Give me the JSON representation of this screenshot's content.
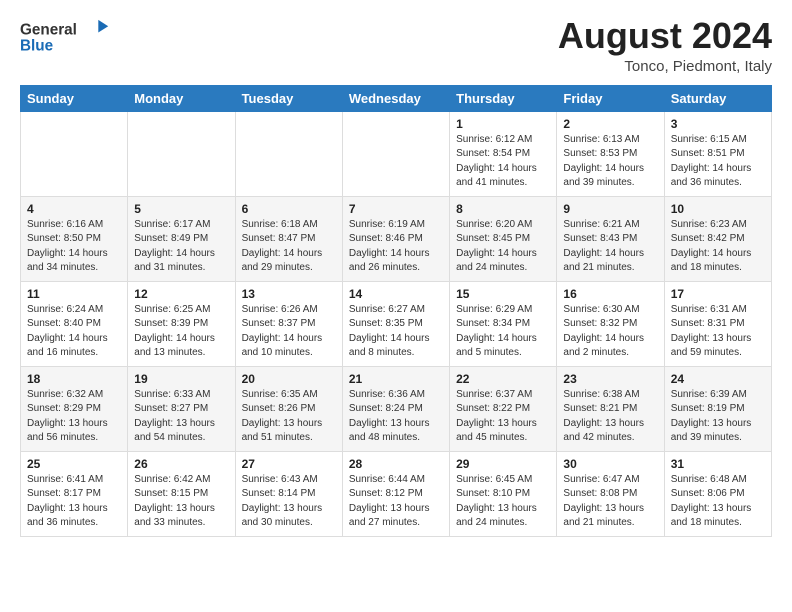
{
  "header": {
    "logo_line1": "General",
    "logo_line2": "Blue",
    "month": "August 2024",
    "location": "Tonco, Piedmont, Italy"
  },
  "days_of_week": [
    "Sunday",
    "Monday",
    "Tuesday",
    "Wednesday",
    "Thursday",
    "Friday",
    "Saturday"
  ],
  "weeks": [
    [
      {
        "day": "",
        "info": ""
      },
      {
        "day": "",
        "info": ""
      },
      {
        "day": "",
        "info": ""
      },
      {
        "day": "",
        "info": ""
      },
      {
        "day": "1",
        "info": "Sunrise: 6:12 AM\nSunset: 8:54 PM\nDaylight: 14 hours\nand 41 minutes."
      },
      {
        "day": "2",
        "info": "Sunrise: 6:13 AM\nSunset: 8:53 PM\nDaylight: 14 hours\nand 39 minutes."
      },
      {
        "day": "3",
        "info": "Sunrise: 6:15 AM\nSunset: 8:51 PM\nDaylight: 14 hours\nand 36 minutes."
      }
    ],
    [
      {
        "day": "4",
        "info": "Sunrise: 6:16 AM\nSunset: 8:50 PM\nDaylight: 14 hours\nand 34 minutes."
      },
      {
        "day": "5",
        "info": "Sunrise: 6:17 AM\nSunset: 8:49 PM\nDaylight: 14 hours\nand 31 minutes."
      },
      {
        "day": "6",
        "info": "Sunrise: 6:18 AM\nSunset: 8:47 PM\nDaylight: 14 hours\nand 29 minutes."
      },
      {
        "day": "7",
        "info": "Sunrise: 6:19 AM\nSunset: 8:46 PM\nDaylight: 14 hours\nand 26 minutes."
      },
      {
        "day": "8",
        "info": "Sunrise: 6:20 AM\nSunset: 8:45 PM\nDaylight: 14 hours\nand 24 minutes."
      },
      {
        "day": "9",
        "info": "Sunrise: 6:21 AM\nSunset: 8:43 PM\nDaylight: 14 hours\nand 21 minutes."
      },
      {
        "day": "10",
        "info": "Sunrise: 6:23 AM\nSunset: 8:42 PM\nDaylight: 14 hours\nand 18 minutes."
      }
    ],
    [
      {
        "day": "11",
        "info": "Sunrise: 6:24 AM\nSunset: 8:40 PM\nDaylight: 14 hours\nand 16 minutes."
      },
      {
        "day": "12",
        "info": "Sunrise: 6:25 AM\nSunset: 8:39 PM\nDaylight: 14 hours\nand 13 minutes."
      },
      {
        "day": "13",
        "info": "Sunrise: 6:26 AM\nSunset: 8:37 PM\nDaylight: 14 hours\nand 10 minutes."
      },
      {
        "day": "14",
        "info": "Sunrise: 6:27 AM\nSunset: 8:35 PM\nDaylight: 14 hours\nand 8 minutes."
      },
      {
        "day": "15",
        "info": "Sunrise: 6:29 AM\nSunset: 8:34 PM\nDaylight: 14 hours\nand 5 minutes."
      },
      {
        "day": "16",
        "info": "Sunrise: 6:30 AM\nSunset: 8:32 PM\nDaylight: 14 hours\nand 2 minutes."
      },
      {
        "day": "17",
        "info": "Sunrise: 6:31 AM\nSunset: 8:31 PM\nDaylight: 13 hours\nand 59 minutes."
      }
    ],
    [
      {
        "day": "18",
        "info": "Sunrise: 6:32 AM\nSunset: 8:29 PM\nDaylight: 13 hours\nand 56 minutes."
      },
      {
        "day": "19",
        "info": "Sunrise: 6:33 AM\nSunset: 8:27 PM\nDaylight: 13 hours\nand 54 minutes."
      },
      {
        "day": "20",
        "info": "Sunrise: 6:35 AM\nSunset: 8:26 PM\nDaylight: 13 hours\nand 51 minutes."
      },
      {
        "day": "21",
        "info": "Sunrise: 6:36 AM\nSunset: 8:24 PM\nDaylight: 13 hours\nand 48 minutes."
      },
      {
        "day": "22",
        "info": "Sunrise: 6:37 AM\nSunset: 8:22 PM\nDaylight: 13 hours\nand 45 minutes."
      },
      {
        "day": "23",
        "info": "Sunrise: 6:38 AM\nSunset: 8:21 PM\nDaylight: 13 hours\nand 42 minutes."
      },
      {
        "day": "24",
        "info": "Sunrise: 6:39 AM\nSunset: 8:19 PM\nDaylight: 13 hours\nand 39 minutes."
      }
    ],
    [
      {
        "day": "25",
        "info": "Sunrise: 6:41 AM\nSunset: 8:17 PM\nDaylight: 13 hours\nand 36 minutes."
      },
      {
        "day": "26",
        "info": "Sunrise: 6:42 AM\nSunset: 8:15 PM\nDaylight: 13 hours\nand 33 minutes."
      },
      {
        "day": "27",
        "info": "Sunrise: 6:43 AM\nSunset: 8:14 PM\nDaylight: 13 hours\nand 30 minutes."
      },
      {
        "day": "28",
        "info": "Sunrise: 6:44 AM\nSunset: 8:12 PM\nDaylight: 13 hours\nand 27 minutes."
      },
      {
        "day": "29",
        "info": "Sunrise: 6:45 AM\nSunset: 8:10 PM\nDaylight: 13 hours\nand 24 minutes."
      },
      {
        "day": "30",
        "info": "Sunrise: 6:47 AM\nSunset: 8:08 PM\nDaylight: 13 hours\nand 21 minutes."
      },
      {
        "day": "31",
        "info": "Sunrise: 6:48 AM\nSunset: 8:06 PM\nDaylight: 13 hours\nand 18 minutes."
      }
    ]
  ]
}
